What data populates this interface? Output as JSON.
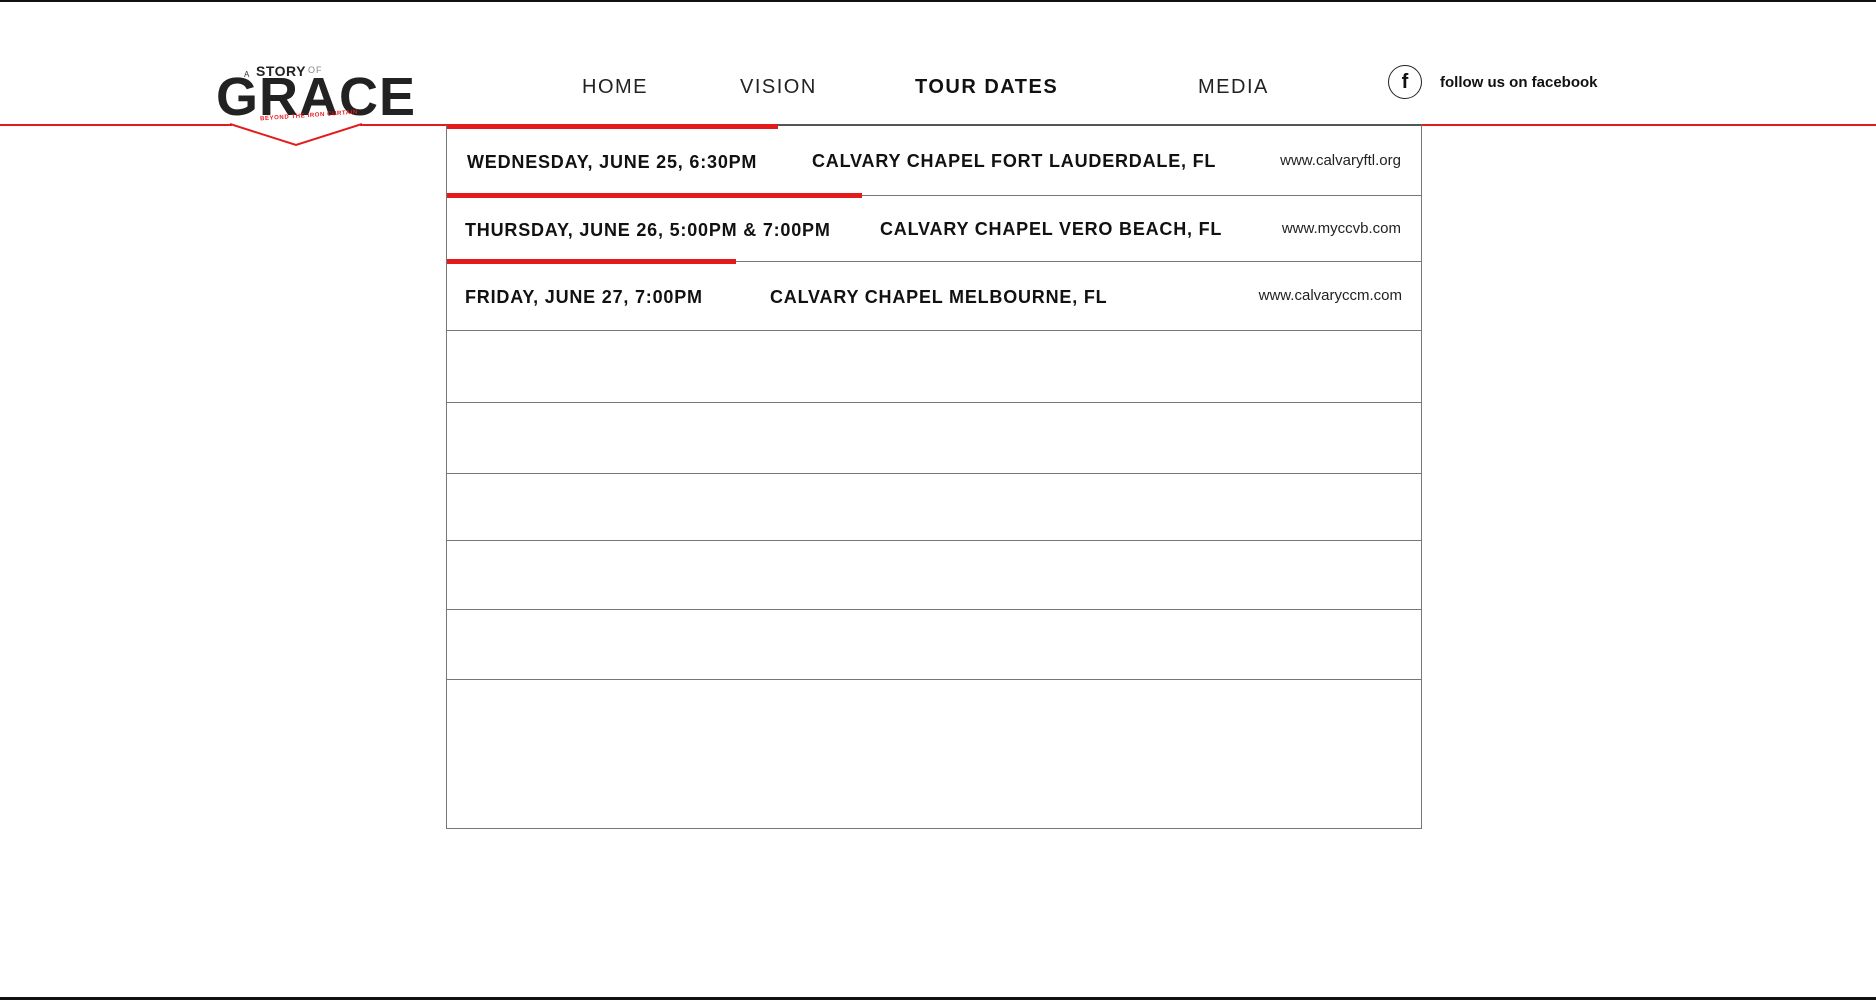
{
  "logo": {
    "a": "A",
    "story": "STORY",
    "of": "OF",
    "grace": "GRACE",
    "tagline": "BEYOND THE IRON CURTAIN"
  },
  "nav": {
    "home": "HOME",
    "vision": "VISION",
    "tour_dates": "TOUR DATES",
    "media": "MEDIA",
    "active": "TOUR DATES"
  },
  "facebook": {
    "icon": "facebook-icon",
    "glyph": "f",
    "label": "follow us on facebook"
  },
  "tour_dates": [
    {
      "date": "WEDNESDAY, JUNE 25, 6:30PM",
      "venue": "CALVARY CHAPEL FORT LAUDERDALE, FL",
      "website": "www.calvaryftl.org"
    },
    {
      "date": "THURSDAY, JUNE 26, 5:00PM & 7:00PM",
      "venue": "CALVARY CHAPEL VERO BEACH, FL",
      "website": "www.myccvb.com"
    },
    {
      "date": "FRIDAY, JUNE 27, 7:00PM",
      "venue": "CALVARY CHAPEL MELBOURNE, FL",
      "website": "www.calvaryccm.com"
    }
  ],
  "colors": {
    "accent": "#e41b1b",
    "text": "#111111",
    "border": "#777777"
  }
}
